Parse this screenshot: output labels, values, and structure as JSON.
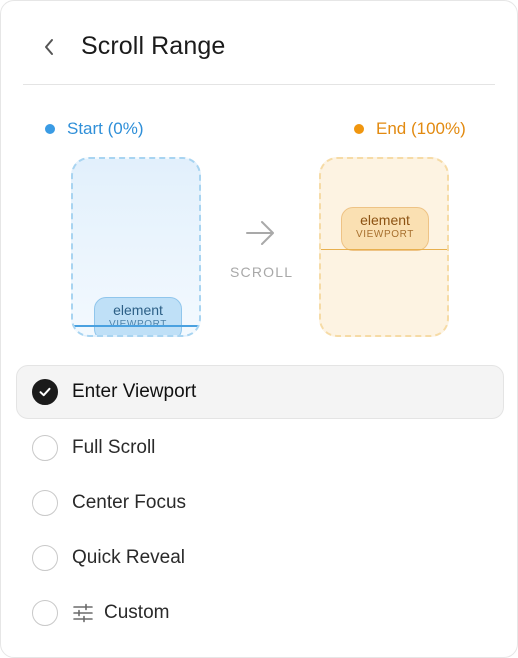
{
  "header": {
    "title": "Scroll Range",
    "back_icon": "chevron-left-icon"
  },
  "preview": {
    "start": {
      "label": "Start (0%)",
      "color": "#3a9be4",
      "element_label": "element",
      "viewport_label": "VIEWPORT"
    },
    "end": {
      "label": "End (100%)",
      "color": "#f0960f",
      "element_label": "element",
      "viewport_label": "VIEWPORT"
    },
    "arrow_icon": "arrow-right-icon",
    "scroll_label": "SCROLL"
  },
  "options": [
    {
      "label": "Enter Viewport",
      "selected": true
    },
    {
      "label": "Full Scroll",
      "selected": false
    },
    {
      "label": "Center Focus",
      "selected": false
    },
    {
      "label": "Quick Reveal",
      "selected": false
    },
    {
      "label": "Custom",
      "selected": false,
      "icon": "sliders-icon"
    }
  ]
}
